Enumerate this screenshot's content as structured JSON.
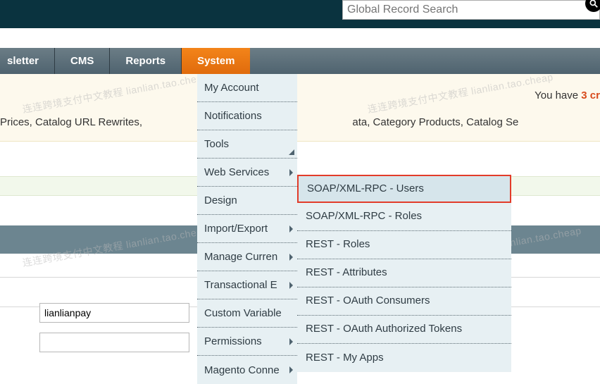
{
  "header": {
    "search_placeholder": "Global Record Search"
  },
  "menubar": {
    "items": [
      "sletter",
      "CMS",
      "Reports",
      "System"
    ],
    "active_index": 3
  },
  "notice": {
    "line1_prefix": "You have ",
    "line1_count": "3",
    "line1_suffix": " cr",
    "line2_left": "Prices, Catalog URL Rewrites, ",
    "line2_right": "ata, Category Products, Catalog Se"
  },
  "system_menu": {
    "items": [
      "My Account",
      "Notifications",
      "Tools",
      "Web Services",
      "Design",
      "Import/Export",
      "Manage Curren",
      "Transactional E",
      "Custom Variable",
      "Permissions",
      "Magento Conne"
    ]
  },
  "webservices_menu": {
    "items": [
      "SOAP/XML-RPC - Users",
      "SOAP/XML-RPC - Roles",
      "REST - Roles",
      "REST - Attributes",
      "REST - OAuth Consumers",
      "REST - OAuth Authorized Tokens",
      "REST - My Apps"
    ],
    "highlight_index": 0
  },
  "form": {
    "field1_value": "lianlianpay",
    "field2_value": ""
  },
  "watermark": "连连跨境支付中文教程 lianlian.tao.cheap"
}
